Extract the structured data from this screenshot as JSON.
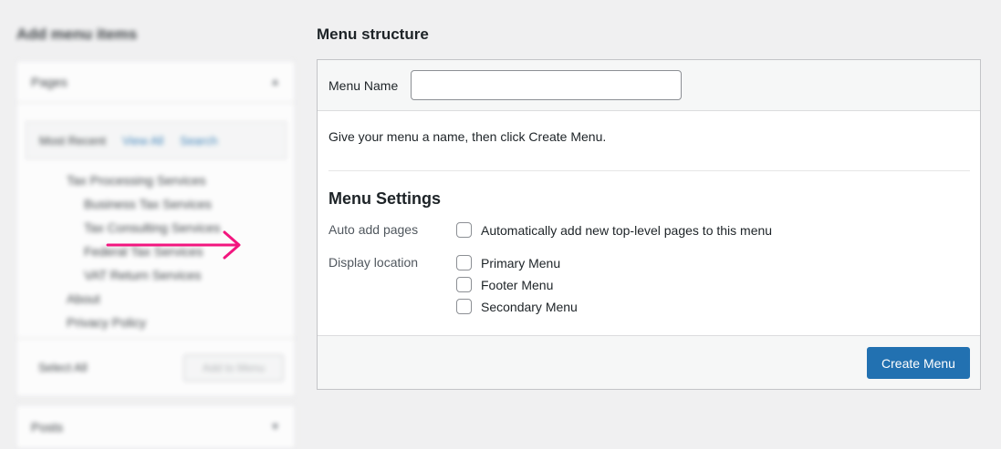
{
  "left": {
    "heading": "Add menu items",
    "pages_box": {
      "title": "Pages",
      "tabs": [
        {
          "label": "Most Recent"
        },
        {
          "label": "View All"
        },
        {
          "label": "Search"
        }
      ],
      "items": [
        {
          "label": "Tax Processing Services",
          "depth": 1
        },
        {
          "label": "Business Tax Services",
          "depth": 2
        },
        {
          "label": "Tax Consulting Services",
          "depth": 2
        },
        {
          "label": "Federal Tax Services",
          "depth": 2
        },
        {
          "label": "VAT Return Services",
          "depth": 2
        },
        {
          "label": "About",
          "depth": 1
        },
        {
          "label": "Privacy Policy",
          "depth": 1
        }
      ],
      "select_all_label": "Select All",
      "add_button_label": "Add to Menu"
    },
    "posts_box": {
      "title": "Posts"
    }
  },
  "menu_structure": {
    "title": "Menu structure",
    "name_label": "Menu Name",
    "name_value": "",
    "instructions": "Give your menu a name, then click Create Menu.",
    "settings_title": "Menu Settings",
    "auto_add": {
      "label": "Auto add pages",
      "option": "Automatically add new top-level pages to this menu"
    },
    "display_location": {
      "label": "Display location",
      "options": [
        {
          "label": "Primary Menu"
        },
        {
          "label": "Footer Menu"
        },
        {
          "label": "Secondary Menu"
        }
      ]
    },
    "create_button_label": "Create Menu"
  },
  "colors": {
    "accent": "#2271b1",
    "arrow": "#f2167f",
    "background": "#f0f0f1"
  },
  "icons": {
    "section_toggle": "chevron-up-icon",
    "annotation": "right-arrow-icon"
  }
}
